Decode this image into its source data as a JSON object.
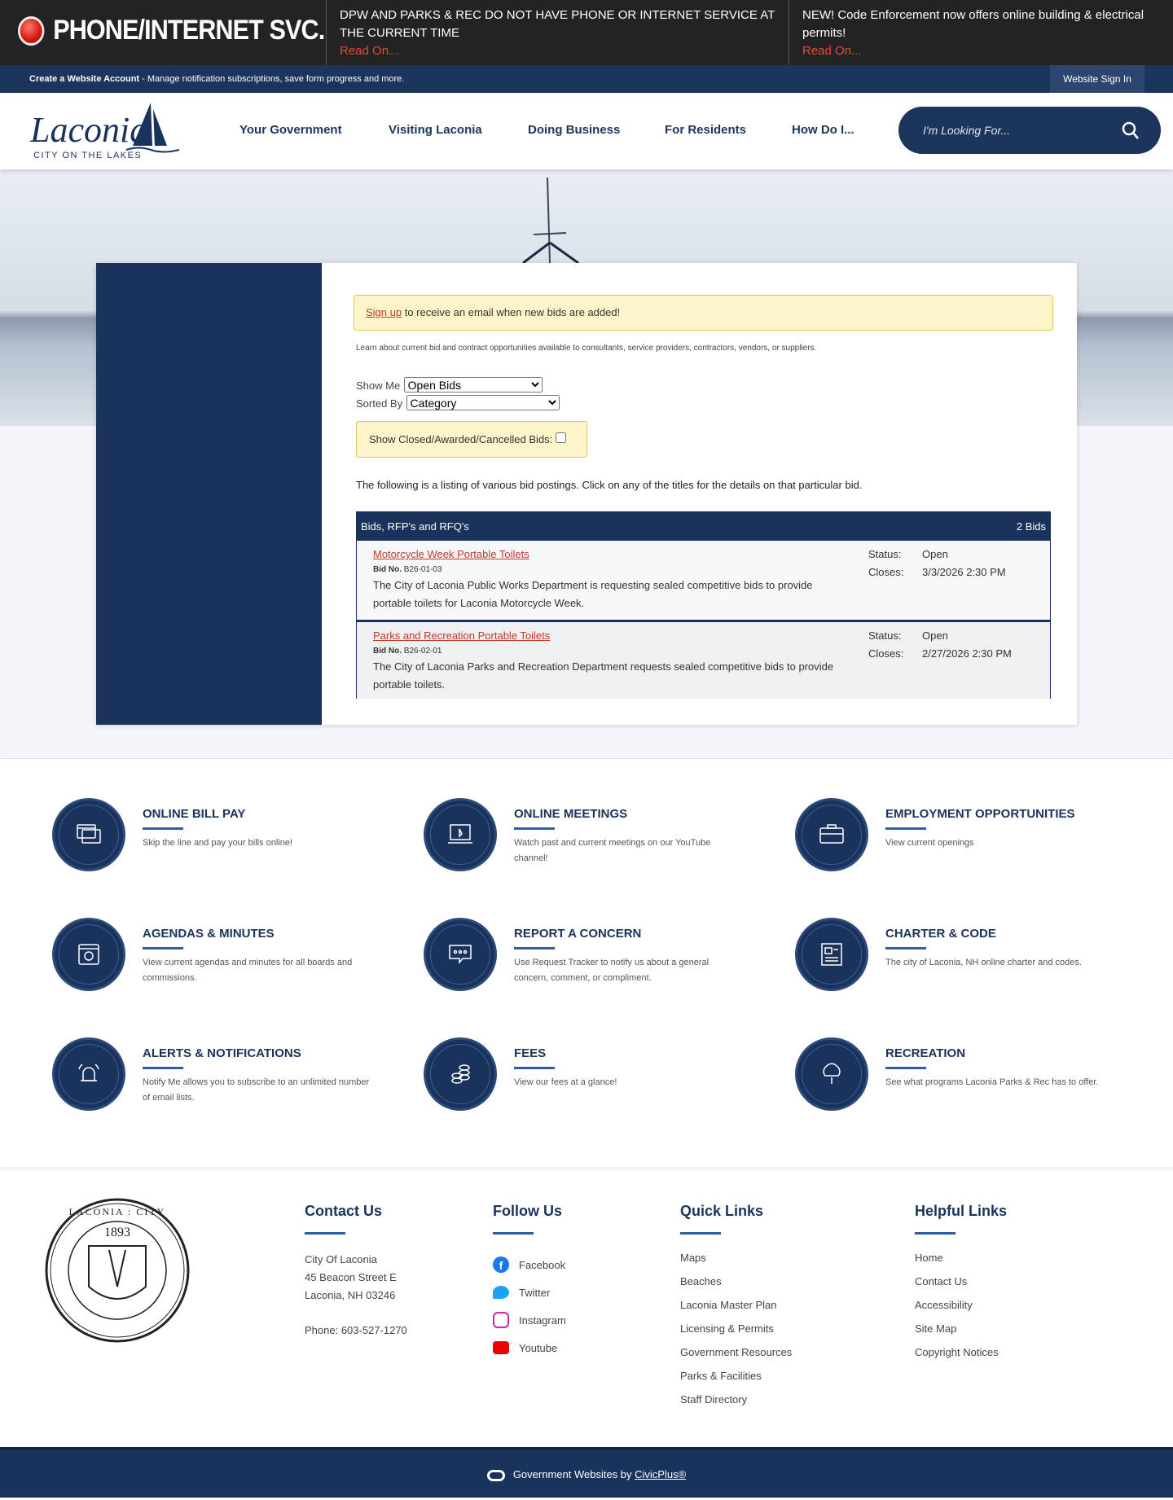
{
  "alerts": {
    "title": "PHONE/INTERNET SVC.",
    "items": [
      {
        "text": "DPW AND PARKS & REC DO NOT HAVE PHONE OR INTERNET SERVICE AT THE CURRENT TIME",
        "link": "Read On..."
      },
      {
        "text": "NEW! Code Enforcement now offers online building & electrical permits!",
        "link": "Read On..."
      }
    ]
  },
  "account": {
    "create": "Create a Website Account",
    "desc": " - Manage notification subscriptions, save form progress and more.",
    "signin": "Website Sign In"
  },
  "logo": {
    "name": "Laconia",
    "tagline": "CITY ON THE LAKES"
  },
  "nav": [
    "Your Government",
    "Visiting Laconia",
    "Doing Business",
    "For Residents",
    "How Do I..."
  ],
  "search": {
    "placeholder": "I'm Looking For..."
  },
  "bids": {
    "signup_link": "Sign up",
    "signup_text": " to receive an email when new bids are added!",
    "intro": "Learn about current bid and contract opportunities available to consultants, service providers, contractors, vendors, or suppliers.",
    "show_me_label": "Show Me",
    "show_me_value": "Open Bids",
    "sorted_by_label": "Sorted By",
    "sorted_by_value": "Category",
    "closed_label": "Show Closed/Awarded/Cancelled Bids:",
    "listing_text": "The following is a listing of various bid postings. Click on any of the titles for the details on that particular bid.",
    "table_title": "Bids, RFP's and RFQ's",
    "count": "2 Bids",
    "items": [
      {
        "title": "Motorcycle Week Portable Toilets",
        "bid_no_label": "Bid No.",
        "bid_no": "B26-01-03",
        "desc": "The City of Laconia Public Works Department is requesting sealed competitive bids to provide portable toilets for Laconia Motorcycle Week.",
        "status_label": "Status:",
        "status": "Open",
        "closes_label": "Closes:",
        "closes": "3/3/2026 2:30 PM"
      },
      {
        "title": "Parks and Recreation Portable Toilets",
        "bid_no_label": "Bid No.",
        "bid_no": "B26-02-01",
        "desc": "The City of Laconia Parks and Recreation Department requests sealed competitive bids to provide portable toilets.",
        "status_label": "Status:",
        "status": "Open",
        "closes_label": "Closes:",
        "closes": "2/27/2026 2:30 PM"
      }
    ]
  },
  "features": [
    {
      "title": "ONLINE BILL PAY",
      "desc": "Skip the line and pay your bills online!",
      "icon": "credit-card-icon"
    },
    {
      "title": "ONLINE MEETINGS",
      "desc": "Watch past and current meetings on our YouTube channel!",
      "icon": "laptop-icon"
    },
    {
      "title": "EMPLOYMENT OPPORTUNITIES",
      "desc": "View current openings",
      "icon": "briefcase-icon"
    },
    {
      "title": "AGENDAS & MINUTES",
      "desc": "View current agendas and minutes for all boards and commissions.",
      "icon": "calendar-icon"
    },
    {
      "title": "REPORT A CONCERN",
      "desc": "Use Request Tracker to notify us about a general concern, comment, or compliment.",
      "icon": "chat-icon"
    },
    {
      "title": "CHARTER & CODE",
      "desc": "The city of Laconia, NH online charter and codes.",
      "icon": "document-icon"
    },
    {
      "title": "ALERTS & NOTIFICATIONS",
      "desc": "Notify Me allows you to subscribe to an unlimited number of email lists.",
      "icon": "bell-icon"
    },
    {
      "title": "FEES",
      "desc": "View our fees at a glance!",
      "icon": "coins-icon"
    },
    {
      "title": "RECREATION",
      "desc": "See what programs Laconia Parks & Rec has to offer.",
      "icon": "tree-icon"
    }
  ],
  "footer": {
    "seal_text": "SEAL OF LACONIA : CITY ON THE LAKES 1893",
    "contact": {
      "heading": "Contact Us",
      "name": "City Of Laconia",
      "street": "45 Beacon Street E",
      "city": "Laconia, NH 03246",
      "phone": "Phone: 603-527-1270"
    },
    "follow": {
      "heading": "Follow Us",
      "items": [
        "Facebook",
        "Twitter",
        "Instagram",
        "Youtube"
      ]
    },
    "quick": {
      "heading": "Quick Links",
      "items": [
        "Maps",
        "Beaches",
        "Laconia Master Plan",
        "Licensing & Permits",
        "Government Resources",
        "Parks & Facilities",
        "Staff Directory"
      ]
    },
    "helpful": {
      "heading": "Helpful Links",
      "items": [
        "Home",
        "Contact Us",
        "Accessibility",
        "Site Map",
        "Copyright Notices"
      ]
    },
    "credit": "Government Websites by ",
    "credit_link": "CivicPlus®"
  }
}
